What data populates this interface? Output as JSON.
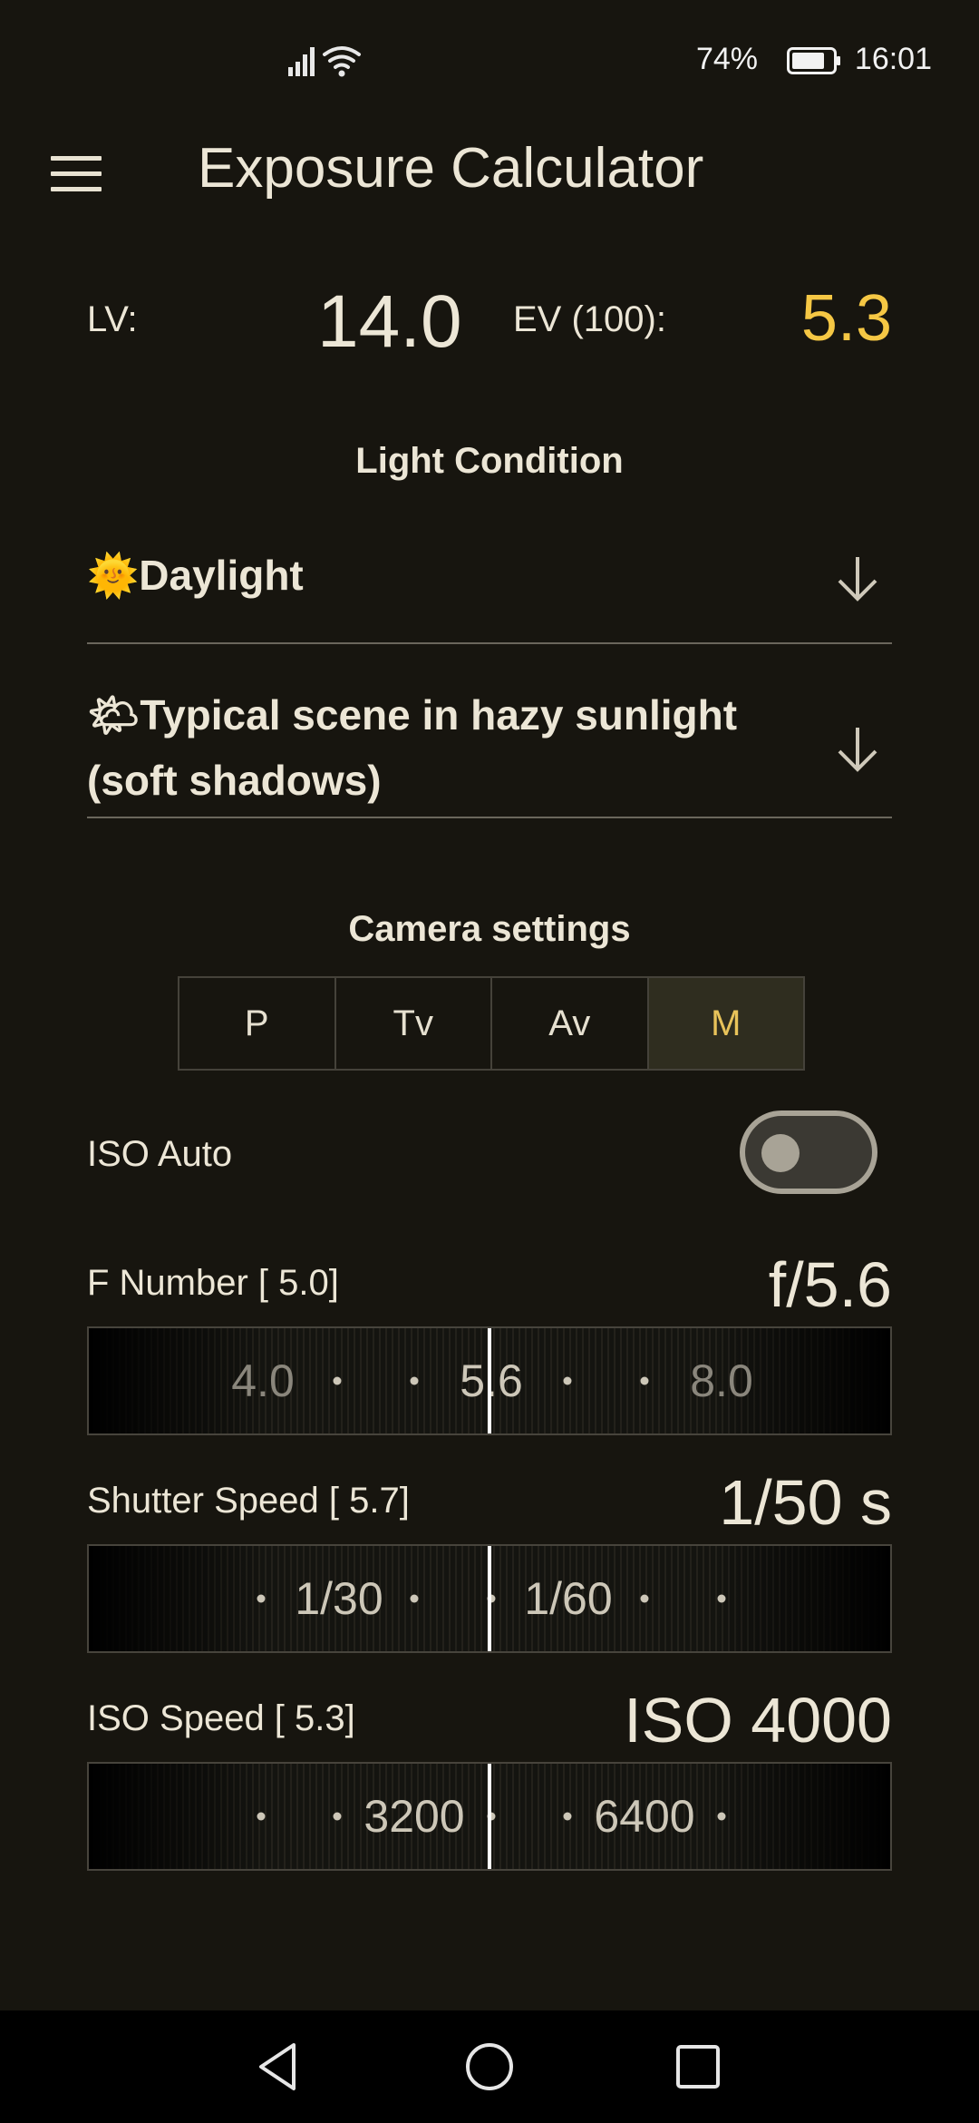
{
  "status_bar": {
    "battery_percent": "74%",
    "time": "16:01",
    "icons": [
      "signal-icon",
      "wifi-icon",
      "battery-icon"
    ]
  },
  "app_bar": {
    "title": "Exposure Calculator",
    "menu_icon": "hamburger-menu-icon"
  },
  "exposure": {
    "lv_label": "LV:",
    "lv_value": "14.0",
    "ev_label": "EV (100):",
    "ev_value": "5.3",
    "ev_color": "#f5c744"
  },
  "light_condition": {
    "title": "Light Condition",
    "category": {
      "emoji": "🌞",
      "label": "Daylight"
    },
    "scene": {
      "emoji": "🌤",
      "label": "Typical scene in hazy sunlight (soft shadows)"
    }
  },
  "camera_settings": {
    "title": "Camera settings",
    "modes": [
      "P",
      "Tv",
      "Av",
      "M"
    ],
    "active_mode": "M",
    "active_color": "#e8c35a"
  },
  "iso_auto": {
    "label": "ISO Auto",
    "enabled": false
  },
  "f_number": {
    "label": "F Number [  5.0]",
    "value": "f/5.6",
    "ticks": [
      "4.0",
      "5.6",
      "8.0"
    ]
  },
  "shutter_speed": {
    "label": "Shutter Speed [  5.7]",
    "value": "1/50 s",
    "ticks": [
      "1/30",
      "1/60"
    ]
  },
  "iso_speed": {
    "label": "ISO Speed [  5.3]",
    "value": "ISO 4000",
    "ticks": [
      "3200",
      "6400"
    ]
  },
  "nav_bar": {
    "buttons": [
      "back-icon",
      "home-icon",
      "recents-icon"
    ]
  }
}
